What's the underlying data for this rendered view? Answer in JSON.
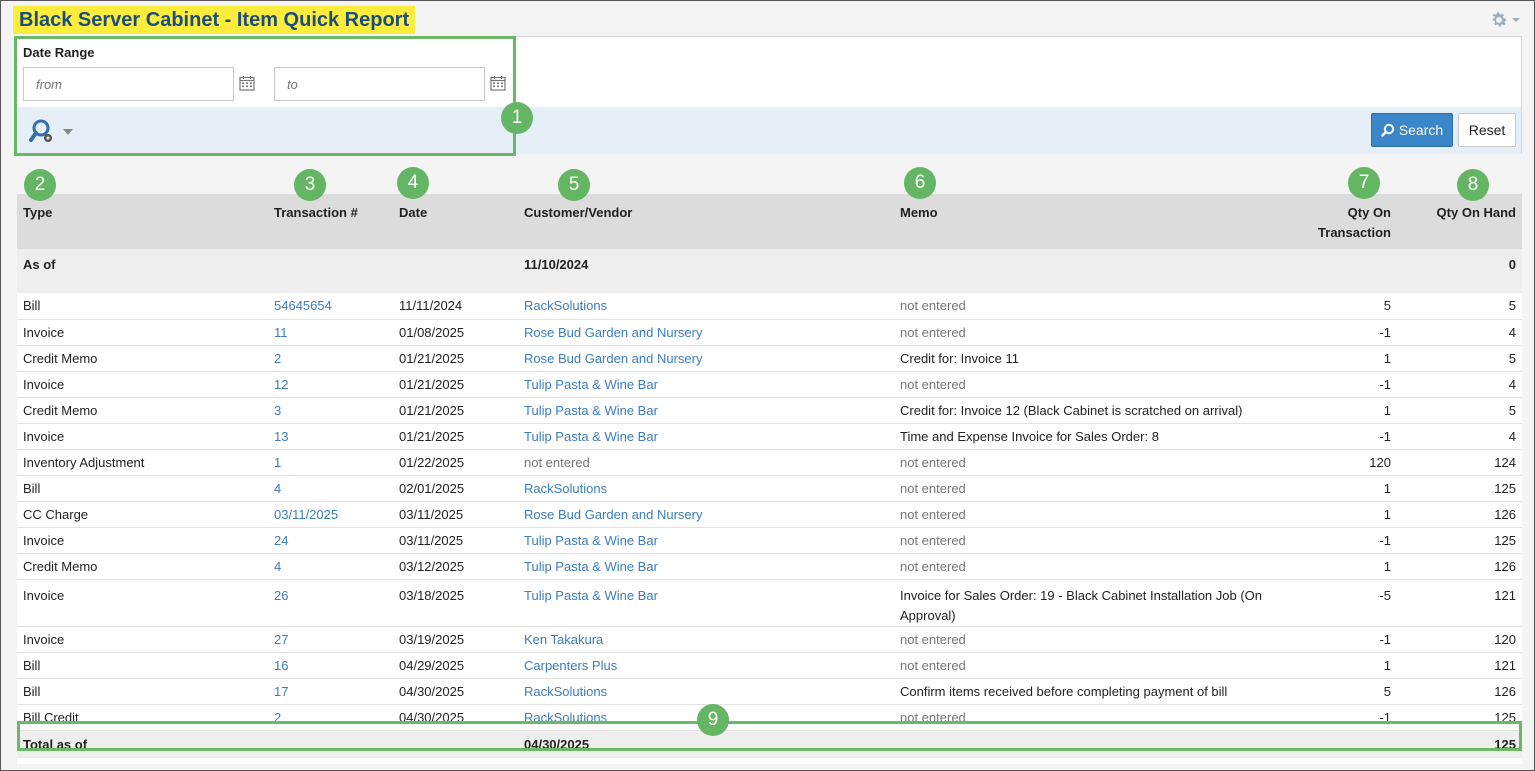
{
  "header": {
    "title": "Black Server Cabinet - Item Quick Report"
  },
  "filters": {
    "date_range_label": "Date Range",
    "from_placeholder": "from",
    "to_placeholder": "to",
    "search_label": "Search",
    "reset_label": "Reset"
  },
  "callouts": [
    "1",
    "2",
    "3",
    "4",
    "5",
    "6",
    "7",
    "8",
    "9"
  ],
  "columns": {
    "type": "Type",
    "txn": "Transaction #",
    "date": "Date",
    "cv": "Customer/Vendor",
    "memo": "Memo",
    "qty_txn": "Qty On Transaction",
    "qty_hand": "Qty On Hand"
  },
  "as_of": {
    "label": "As of",
    "date": "11/10/2024",
    "qty_hand": "0"
  },
  "rows": [
    {
      "type": "Bill",
      "txn": "54645654",
      "date": "11/11/2024",
      "cv": "RackSolutions",
      "cv_link": true,
      "memo": "not entered",
      "memo_muted": true,
      "qty_txn": "5",
      "qty_hand": "5"
    },
    {
      "type": "Invoice",
      "txn": "11",
      "date": "01/08/2025",
      "cv": "Rose Bud Garden and Nursery",
      "cv_link": true,
      "memo": "not entered",
      "memo_muted": true,
      "qty_txn": "-1",
      "qty_hand": "4"
    },
    {
      "type": "Credit Memo",
      "txn": "2",
      "date": "01/21/2025",
      "cv": "Rose Bud Garden and Nursery",
      "cv_link": true,
      "memo": "Credit for: Invoice 11",
      "memo_muted": false,
      "qty_txn": "1",
      "qty_hand": "5"
    },
    {
      "type": "Invoice",
      "txn": "12",
      "date": "01/21/2025",
      "cv": "Tulip Pasta & Wine Bar",
      "cv_link": true,
      "memo": "not entered",
      "memo_muted": true,
      "qty_txn": "-1",
      "qty_hand": "4"
    },
    {
      "type": "Credit Memo",
      "txn": "3",
      "date": "01/21/2025",
      "cv": "Tulip Pasta & Wine Bar",
      "cv_link": true,
      "memo": "Credit for: Invoice 12 (Black Cabinet is scratched on arrival)",
      "memo_muted": false,
      "qty_txn": "1",
      "qty_hand": "5"
    },
    {
      "type": "Invoice",
      "txn": "13",
      "date": "01/21/2025",
      "cv": "Tulip Pasta & Wine Bar",
      "cv_link": true,
      "memo": "Time and Expense Invoice for Sales Order: 8",
      "memo_muted": false,
      "qty_txn": "-1",
      "qty_hand": "4"
    },
    {
      "type": "Inventory Adjustment",
      "txn": "1",
      "date": "01/22/2025",
      "cv": "not entered",
      "cv_link": false,
      "memo": "not entered",
      "memo_muted": true,
      "qty_txn": "120",
      "qty_hand": "124"
    },
    {
      "type": "Bill",
      "txn": "4",
      "date": "02/01/2025",
      "cv": "RackSolutions",
      "cv_link": true,
      "memo": "not entered",
      "memo_muted": true,
      "qty_txn": "1",
      "qty_hand": "125"
    },
    {
      "type": "CC Charge",
      "txn": "03/11/2025",
      "date": "03/11/2025",
      "cv": "Rose Bud Garden and Nursery",
      "cv_link": true,
      "memo": "not entered",
      "memo_muted": true,
      "qty_txn": "1",
      "qty_hand": "126"
    },
    {
      "type": "Invoice",
      "txn": "24",
      "date": "03/11/2025",
      "cv": "Tulip Pasta & Wine Bar",
      "cv_link": true,
      "memo": "not entered",
      "memo_muted": true,
      "qty_txn": "-1",
      "qty_hand": "125"
    },
    {
      "type": "Credit Memo",
      "txn": "4",
      "date": "03/12/2025",
      "cv": "Tulip Pasta & Wine Bar",
      "cv_link": true,
      "memo": "not entered",
      "memo_muted": true,
      "qty_txn": "1",
      "qty_hand": "126"
    },
    {
      "type": "Invoice",
      "txn": "26",
      "date": "03/18/2025",
      "cv": "Tulip Pasta & Wine Bar",
      "cv_link": true,
      "memo": "Invoice for Sales Order: 19 - Black Cabinet Installation Job (On Approval)",
      "memo_muted": false,
      "qty_txn": "-5",
      "qty_hand": "121",
      "tall": true
    },
    {
      "type": "Invoice",
      "txn": "27",
      "date": "03/19/2025",
      "cv": "Ken Takakura",
      "cv_link": true,
      "memo": "not entered",
      "memo_muted": true,
      "qty_txn": "-1",
      "qty_hand": "120"
    },
    {
      "type": "Bill",
      "txn": "16",
      "date": "04/29/2025",
      "cv": "Carpenters Plus",
      "cv_link": true,
      "memo": "not entered",
      "memo_muted": true,
      "qty_txn": "1",
      "qty_hand": "121"
    },
    {
      "type": "Bill",
      "txn": "17",
      "date": "04/30/2025",
      "cv": "RackSolutions",
      "cv_link": true,
      "memo": "Confirm items received before completing payment of bill",
      "memo_muted": false,
      "qty_txn": "5",
      "qty_hand": "126"
    },
    {
      "type": "Bill Credit",
      "txn": "2",
      "date": "04/30/2025",
      "cv": "RackSolutions",
      "cv_link": true,
      "memo": "not entered",
      "memo_muted": true,
      "qty_txn": "-1",
      "qty_hand": "125"
    }
  ],
  "total": {
    "label": "Total as of",
    "date": "04/30/2025",
    "qty_hand": "125"
  },
  "colors": {
    "title_highlight": "#fcec3c",
    "title_text": "#1b4d7d",
    "link": "#3b7dbd",
    "primary_button": "#3a86c8",
    "callout_green": "#64b665"
  }
}
